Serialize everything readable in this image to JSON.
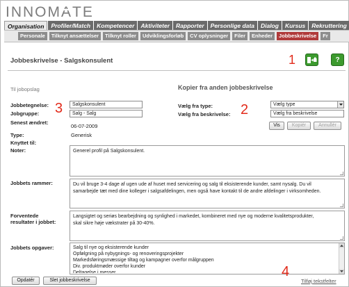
{
  "brand": {
    "logo_text_pre": "INNOM",
    "logo_text_a": "A",
    "logo_text_post": "TE"
  },
  "nav": {
    "tabs": [
      {
        "label": "Organisation",
        "active": true
      },
      {
        "label": "Profiler/Match",
        "active": false
      },
      {
        "label": "Kompetencer",
        "active": false
      },
      {
        "label": "Aktiviteter",
        "active": false
      },
      {
        "label": "Rapporter",
        "active": false
      },
      {
        "label": "Personlige data",
        "active": false
      },
      {
        "label": "Dialog",
        "active": false
      },
      {
        "label": "Kursus",
        "active": false
      },
      {
        "label": "Rekruttering",
        "active": false
      }
    ],
    "subtabs": [
      {
        "label": "Personale",
        "active": false
      },
      {
        "label": "Tilknyt ansættelser",
        "active": false
      },
      {
        "label": "Tilknyt roller",
        "active": false
      },
      {
        "label": "Udviklingsforløb",
        "active": false
      },
      {
        "label": "CV oplysninger",
        "active": false
      },
      {
        "label": "Filer",
        "active": false
      },
      {
        "label": "Enheder",
        "active": false
      },
      {
        "label": "Jobbeskrivelse",
        "active": true
      },
      {
        "label": "Fr",
        "active": false
      }
    ]
  },
  "page": {
    "title": "Jobbeskrivelse - Salgskonsulent",
    "help_label": "?",
    "back_link": "Til jobopslag",
    "callouts": {
      "c1": "1",
      "c2": "2",
      "c3": "3",
      "c4": "4"
    }
  },
  "colors": {
    "accent_active_subtab": "#b03a3a",
    "icon_green": "#3c9a2e",
    "callout_red": "#e22a1a"
  },
  "form": {
    "jobbetegnelse_label": "Jobbetegnelse:",
    "jobbetegnelse_value": "Salgskonsulent",
    "jobgruppe_label": "Jobgruppe:",
    "jobgruppe_value": "Salg - Salg",
    "senest_label": "Senest ændret:",
    "senest_value": "06-07-2009",
    "type_label": "Type:",
    "type_value": "Generisk",
    "knyttet_label": "Knyttet til:",
    "noter_label": "Noter:",
    "noter_value": "Generel profil på Salgskonsulent.",
    "rammer_label": "Jobbets rammer:",
    "rammer_lines": [
      "Du vil bruge 3-4 dage af ugen ude af huset med servicering og salg til eksisterende kunder, samt nysalg. Du vil",
      "samarbejde tæt med dine kolleger i salgsafdelingen, men også have kontakt til de andre afdelinger i virksomheden."
    ],
    "forventede_label_1": "Forventede",
    "forventede_label_2": "resultater i jobbet:",
    "forventede_lines": [
      "Langsigtet og seriøs bearbejdning og synlighed i markedet, kombineret med nye og moderne kvalitetsprodukter,",
      "skal sikre høje vækstrater på 30-40%."
    ],
    "opgaver_label": "Jobbets opgaver:",
    "opgaver_lines": [
      "Salg til nye og eksisterende kunder",
      "Opfølgning på nybygnings- og renoveringsprojekter",
      "Markedsføringsmæssige tiltag og kampagner overfor målgruppen",
      "Div. produktmøder overfor kunder",
      "Deltagelse i messer"
    ]
  },
  "copy_panel": {
    "title": "Kopier fra anden jobbeskrivelse",
    "type_label": "Vælg fra type:",
    "type_select": "Vælg type",
    "desc_label": "Vælg fra beskrivelse:",
    "desc_select": "Vælg fra beskrivelse",
    "vis_button": "Vis",
    "kopier_button": "Kopiér",
    "annuller_button": "Annullér"
  },
  "footer": {
    "opdater_button": "Opdatér",
    "slet_button": "Slet jobbeskrivelse",
    "tilfoj_link": "Tilføj tekstfelter"
  }
}
